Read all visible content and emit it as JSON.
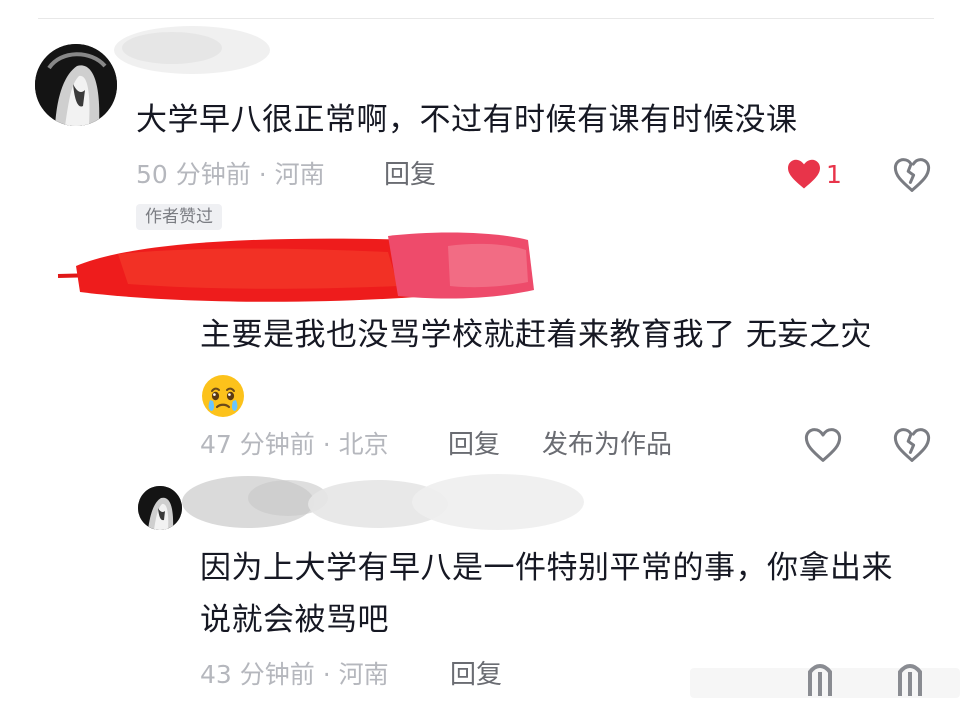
{
  "comments": [
    {
      "text": "大学早八很正常啊，不过有时候有课有时候没课",
      "time": "50 分钟前 · 河南",
      "reply_label": "回复",
      "like_count": "1",
      "badge": "作者赞过"
    },
    {
      "text_line1": "主要是我也没骂学校就赶着来教育我了 无妄之灾",
      "time": "47 分钟前 · 北京",
      "reply_label": "回复",
      "publish_label": "发布为作品"
    },
    {
      "text_line1": "因为上大学有早八是一件特别平常的事，你拿出来",
      "text_line2": "说就会被骂吧",
      "time": "43 分钟前 · 河南",
      "reply_label": "回复"
    }
  ],
  "colors": {
    "liked": "#e8344a",
    "meta": "#b5b7bd",
    "redaction_red": "#ee1c1c",
    "redaction_pink": "#ee4b6b"
  },
  "icons": [
    "heart-filled-icon",
    "heart-outline-icon",
    "heart-broken-icon",
    "crying-emoji-icon"
  ]
}
